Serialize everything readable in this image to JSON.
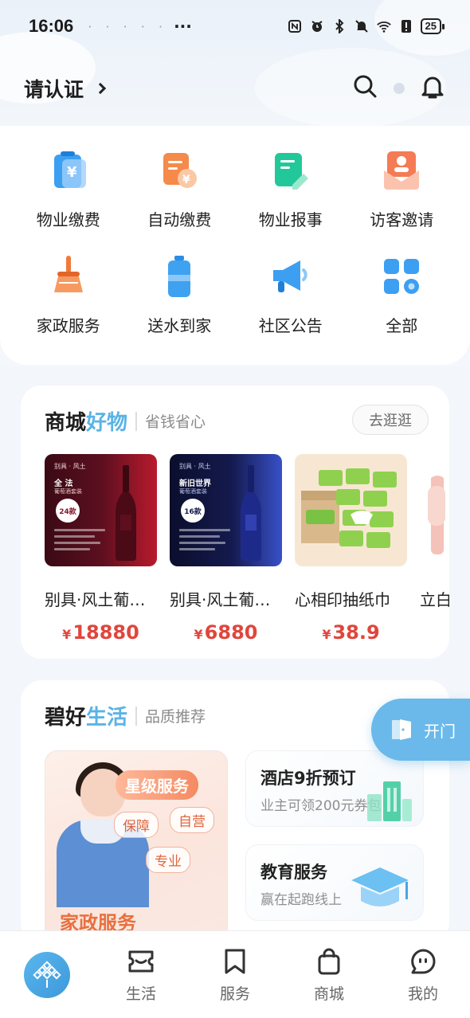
{
  "status_bar": {
    "time": "16:06",
    "more": "···",
    "battery": "25"
  },
  "header": {
    "verify_label": "请认证",
    "search_icon": "search-icon",
    "bell_icon": "bell-icon"
  },
  "quick_actions": [
    {
      "label": "物业缴费",
      "icon": "property-fee-icon"
    },
    {
      "label": "自动缴费",
      "icon": "auto-pay-icon"
    },
    {
      "label": "物业报事",
      "icon": "report-icon"
    },
    {
      "label": "访客邀请",
      "icon": "visitor-invite-icon"
    },
    {
      "label": "家政服务",
      "icon": "broom-icon"
    },
    {
      "label": "送水到家",
      "icon": "water-bottle-icon"
    },
    {
      "label": "社区公告",
      "icon": "megaphone-icon"
    },
    {
      "label": "全部",
      "icon": "all-apps-icon"
    }
  ],
  "shop": {
    "title": "商城",
    "title_accent": "好物",
    "subtitle": "省钱省心",
    "more_button": "去逛逛",
    "products": [
      {
        "name": "别具·风土葡萄酒",
        "price": "18880",
        "currency": "¥",
        "img_brand": "别具 · 风土",
        "img_head": "全 法",
        "img_subhead": "葡萄酒套装",
        "img_badge": "24款"
      },
      {
        "name": "别具·风土葡萄酒",
        "price": "6880",
        "currency": "¥",
        "img_brand": "别具 · 风土",
        "img_head": "新旧世界",
        "img_subhead": "葡萄酒套装",
        "img_badge": "16款"
      },
      {
        "name": "心相印抽纸巾",
        "price": "38.9",
        "currency": "¥"
      },
      {
        "name": "立白",
        "price": ""
      }
    ]
  },
  "life": {
    "title": "碧好",
    "title_accent": "生活",
    "subtitle": "品质推荐",
    "banner": {
      "star_label": "星级服务",
      "tags": [
        "保障",
        "自营",
        "专业"
      ],
      "service_label": "家政服务"
    },
    "cards": [
      {
        "title": "酒店9折预订",
        "subtitle": "业主可领200元券包"
      },
      {
        "title": "教育服务",
        "subtitle": "赢在起跑线上"
      }
    ]
  },
  "door_button": {
    "label": "开门",
    "icon": "door-icon"
  },
  "tabbar": {
    "tabs": [
      {
        "label": "生活",
        "icon": "life-icon"
      },
      {
        "label": "服务",
        "icon": "bookmark-icon"
      },
      {
        "label": "商城",
        "icon": "shopping-bag-icon"
      },
      {
        "label": "我的",
        "icon": "profile-icon"
      }
    ]
  },
  "colors": {
    "accent": "#5ab3e6",
    "price": "#e0463c",
    "door": "#6ab9ea"
  }
}
